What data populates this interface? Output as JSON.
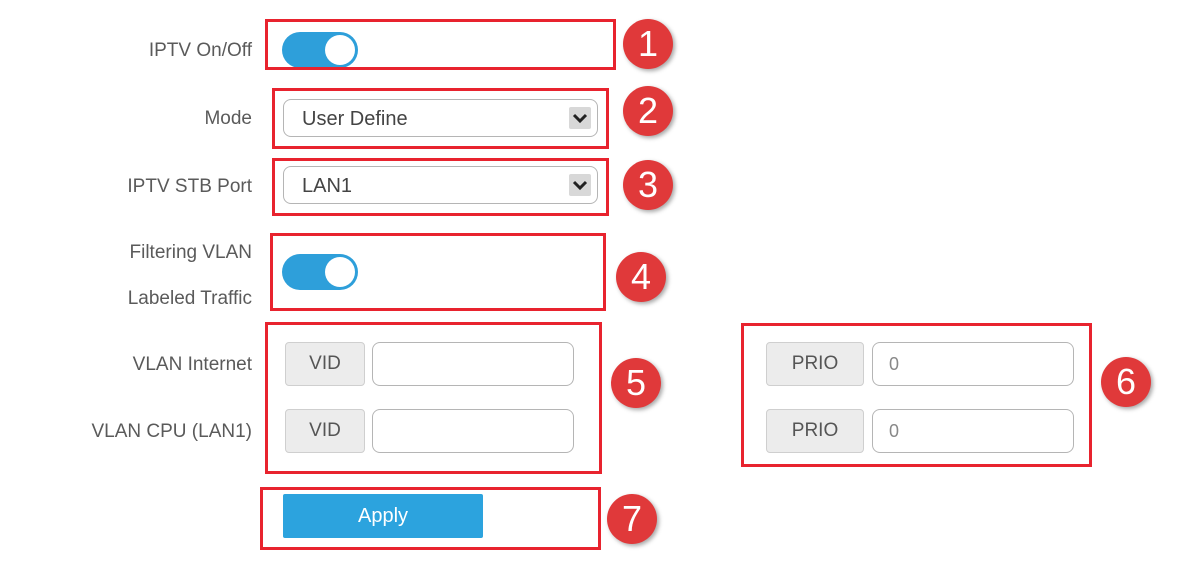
{
  "form": {
    "iptv_label": "IPTV On/Off",
    "iptv_on": true,
    "mode_label": "Mode",
    "mode_value": "User Define",
    "stb_label": "IPTV STB Port",
    "stb_value": "LAN1",
    "filtering_label_line1": "Filtering VLAN",
    "filtering_label_line2": "Labeled Traffic",
    "filtering_on": true,
    "vlan_internet_label": "VLAN Internet",
    "vlan_cpu_label": "VLAN CPU (LAN1)",
    "vid_label": "VID",
    "prio_label": "PRIO",
    "vlan_internet_vid": "",
    "vlan_cpu_vid": "",
    "vlan_internet_prio": "0",
    "vlan_cpu_prio": "0",
    "apply_label": "Apply"
  },
  "callouts": [
    "1",
    "2",
    "3",
    "4",
    "5",
    "6",
    "7"
  ],
  "colors": {
    "toggle_on": "#2e9fda",
    "apply_bg": "#2ca3de",
    "callout_red": "#e8232e",
    "badge_red": "#e0393a"
  }
}
